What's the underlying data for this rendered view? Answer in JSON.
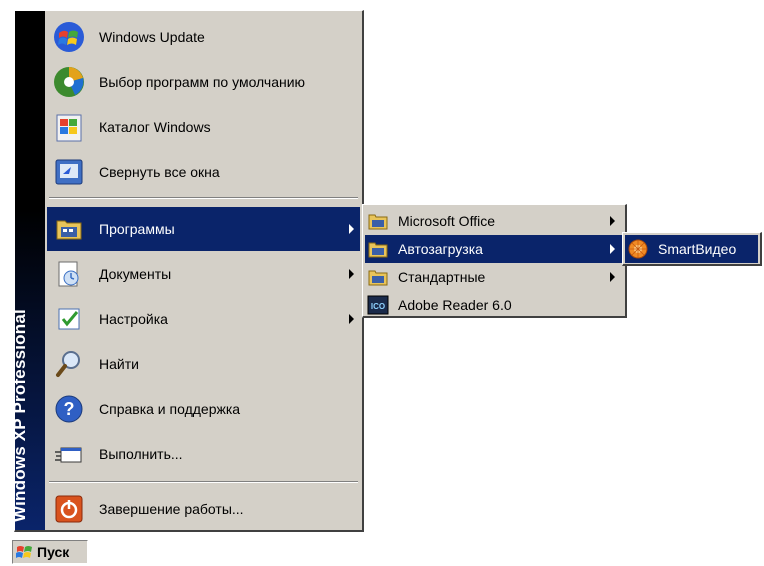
{
  "start_menu": {
    "banner_main": "Windows XP",
    "banner_edition": "Professional",
    "top_items": [
      {
        "label": "Windows Update",
        "icon": "windows-update-icon"
      },
      {
        "label": "Выбор программ по умолчанию",
        "icon": "default-programs-icon"
      },
      {
        "label": "Каталог Windows",
        "icon": "windows-catalog-icon"
      },
      {
        "label": "Свернуть все окна",
        "icon": "show-desktop-icon"
      }
    ],
    "main_items": [
      {
        "label": "Программы",
        "icon": "programs-folder-icon",
        "has_submenu": true,
        "selected": true
      },
      {
        "label": "Документы",
        "icon": "documents-icon",
        "has_submenu": true
      },
      {
        "label": "Настройка",
        "icon": "settings-icon",
        "has_submenu": true
      },
      {
        "label": "Найти",
        "icon": "search-icon"
      },
      {
        "label": "Справка и поддержка",
        "icon": "help-icon"
      },
      {
        "label": "Выполнить...",
        "icon": "run-icon"
      }
    ],
    "shutdown": {
      "label": "Завершение работы...",
      "icon": "power-icon"
    }
  },
  "programs_submenu": {
    "items": [
      {
        "label": "Microsoft Office",
        "icon": "program-group-icon",
        "has_submenu": true
      },
      {
        "label": "Автозагрузка",
        "icon": "program-group-icon",
        "has_submenu": true,
        "selected": true
      },
      {
        "label": "Стандартные",
        "icon": "program-group-icon",
        "has_submenu": true
      },
      {
        "label": "Adobe Reader 6.0",
        "icon": "adobe-reader-icon"
      }
    ]
  },
  "startup_submenu": {
    "items": [
      {
        "label": "SmartВидео",
        "icon": "smartvideo-icon",
        "selected": true
      }
    ]
  },
  "taskbar": {
    "start_label": "Пуск"
  },
  "colors": {
    "menu_bg": "#d4d0c8",
    "highlight": "#0a246a",
    "banner_gradient_end": "#0a246a"
  }
}
